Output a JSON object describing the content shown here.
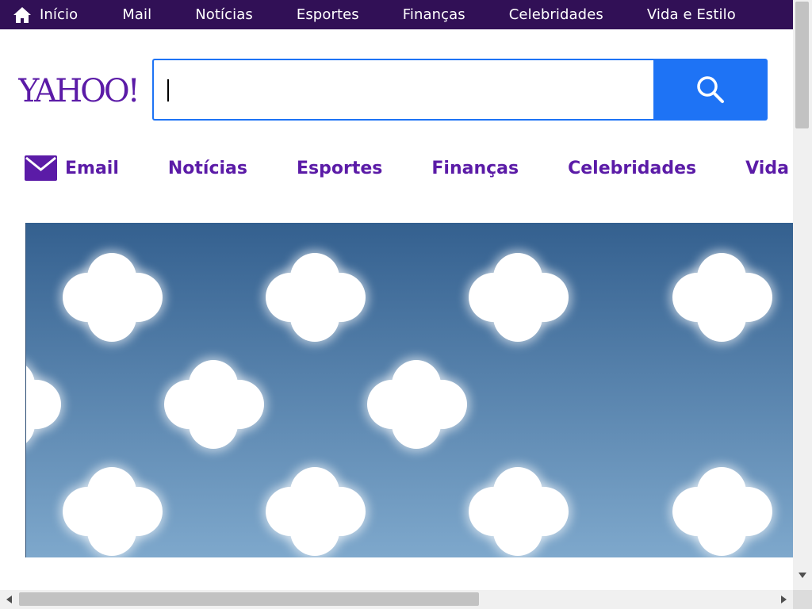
{
  "top_nav": {
    "items": [
      {
        "label": "Início",
        "icon": "home-icon"
      },
      {
        "label": "Mail"
      },
      {
        "label": "Notícias"
      },
      {
        "label": "Esportes"
      },
      {
        "label": "Finanças"
      },
      {
        "label": "Celebridades"
      },
      {
        "label": "Vida e Estilo"
      }
    ]
  },
  "logo": {
    "text": "YAHOO!"
  },
  "search": {
    "value": "",
    "placeholder": "",
    "button_icon": "search-icon"
  },
  "sub_nav": {
    "items": [
      {
        "label": "Email",
        "icon": "mail-icon"
      },
      {
        "label": "Notícias"
      },
      {
        "label": "Esportes"
      },
      {
        "label": "Finanças"
      },
      {
        "label": "Celebridades"
      },
      {
        "label": "Vida"
      }
    ]
  },
  "colors": {
    "top_bar": "#311056",
    "brand_purple": "#5b1ba7",
    "search_blue": "#1e73f5",
    "hero_top": "#34608f",
    "hero_bottom": "#7ea8cc"
  }
}
